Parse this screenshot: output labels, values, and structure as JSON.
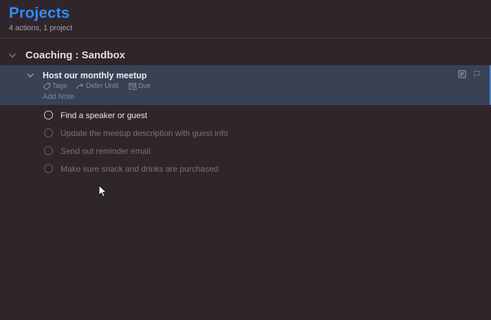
{
  "header": {
    "title": "Projects",
    "subtitle": "4 actions, 1 project"
  },
  "folder": {
    "title": "Coaching : Sandbox"
  },
  "project": {
    "title": "Host our monthly meetup",
    "tags_label": "Tags",
    "defer_label": "Defer Until",
    "due_label": "Due",
    "note_placeholder": "Add Note"
  },
  "tasks": [
    {
      "label": "Find a speaker or guest",
      "available": true
    },
    {
      "label": "Update the meetup description with guest info",
      "available": false
    },
    {
      "label": "Send out reminder email",
      "available": false
    },
    {
      "label": "Make sure snack and drinks are purchased",
      "available": false
    }
  ],
  "colors": {
    "background": "#2f262b",
    "title_blue": "#2f8cf6",
    "selected_row": "#394254",
    "accent": "#4f83c8"
  },
  "icons": [
    "chevron-down-icon",
    "tag-icon",
    "defer-arrow-icon",
    "calendar-icon",
    "note-icon",
    "flag-icon",
    "status-circle-icon",
    "mouse-cursor-icon"
  ]
}
